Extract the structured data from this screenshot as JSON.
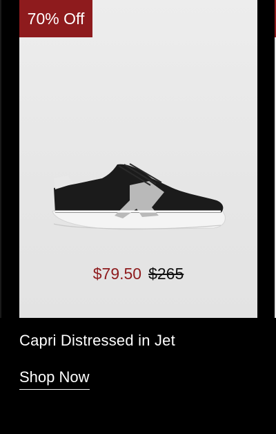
{
  "product": {
    "badge": "70% Off",
    "sale_price": "$79.50",
    "original_price": "$265",
    "name": "Capri Distressed in Jet",
    "cta": "Shop Now"
  },
  "colors": {
    "badge_bg": "#8e1b1d",
    "sale_price": "#8e1b1d",
    "background": "#000000",
    "card_bg": "#e6e6e6"
  }
}
